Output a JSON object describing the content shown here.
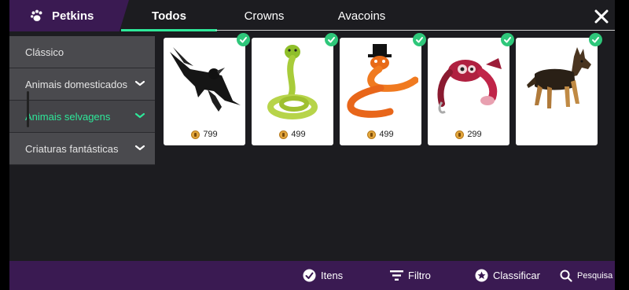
{
  "header": {
    "brand_title": "Petkins",
    "tabs": [
      {
        "label": "Todos",
        "active": true
      },
      {
        "label": "Crowns",
        "active": false
      },
      {
        "label": "Avacoins",
        "active": false
      }
    ]
  },
  "sidebar": {
    "items": [
      {
        "label": "Clássico",
        "expandable": false,
        "active": false
      },
      {
        "label": "Animais domesticados",
        "expandable": true,
        "active": false
      },
      {
        "label": "Animais selvagens",
        "expandable": true,
        "active": true
      },
      {
        "label": "Criaturas fantásticas",
        "expandable": true,
        "active": false
      }
    ]
  },
  "items": [
    {
      "name": "crow",
      "price": "799",
      "owned": true,
      "icon": "crow-icon"
    },
    {
      "name": "green-snake",
      "price": "499",
      "owned": true,
      "icon": "snake-icon"
    },
    {
      "name": "orange-snake-top-hat",
      "price": "499",
      "owned": true,
      "icon": "snake-hat-icon"
    },
    {
      "name": "crab",
      "price": "299",
      "owned": true,
      "icon": "crab-icon"
    },
    {
      "name": "german-shepherd",
      "price": "",
      "owned": true,
      "icon": "dog-icon"
    }
  ],
  "bottom_bar": {
    "itens_label": "Itens",
    "filtro_label": "Filtro",
    "classificar_label": "Classificar",
    "pesquisa_label": "Pesquisa"
  },
  "colors": {
    "accent": "#2ee89a",
    "brand_purple": "#3a1a52",
    "owned_check": "#2ec77a",
    "background": "#1c1c20"
  }
}
